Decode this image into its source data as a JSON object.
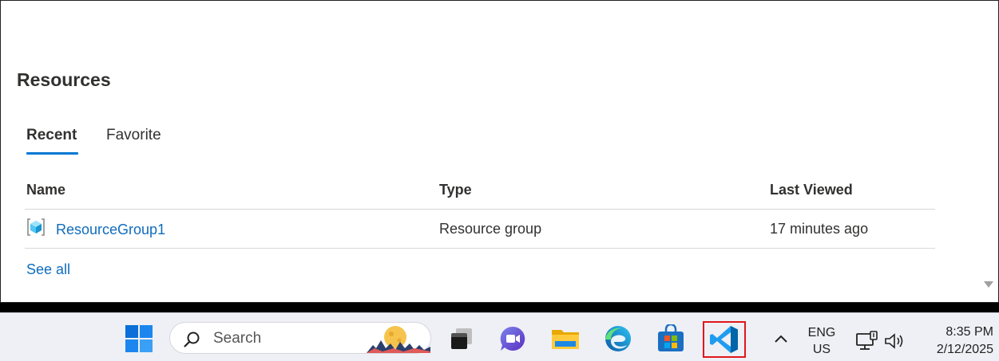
{
  "resources": {
    "title": "Resources",
    "tabs": [
      {
        "label": "Recent",
        "selected": true
      },
      {
        "label": "Favorite",
        "selected": false
      }
    ],
    "columns": [
      "Name",
      "Type",
      "Last Viewed"
    ],
    "rows": [
      {
        "name": "ResourceGroup1",
        "type": "Resource group",
        "last_viewed": "17 minutes ago",
        "icon": "resource-group-icon"
      }
    ],
    "see_all": "See all"
  },
  "colors": {
    "accent": "#0078d4",
    "link": "#0f6cbd",
    "highlight_box": "#e1161b"
  },
  "taskbar": {
    "search_placeholder": "Search",
    "apps": [
      "start",
      "search",
      "task-view",
      "chat",
      "file-explorer",
      "edge",
      "microsoft-store",
      "visual-studio-code"
    ],
    "language_line1": "ENG",
    "language_line2": "US",
    "time": "8:35 PM",
    "date": "2/12/2025"
  }
}
